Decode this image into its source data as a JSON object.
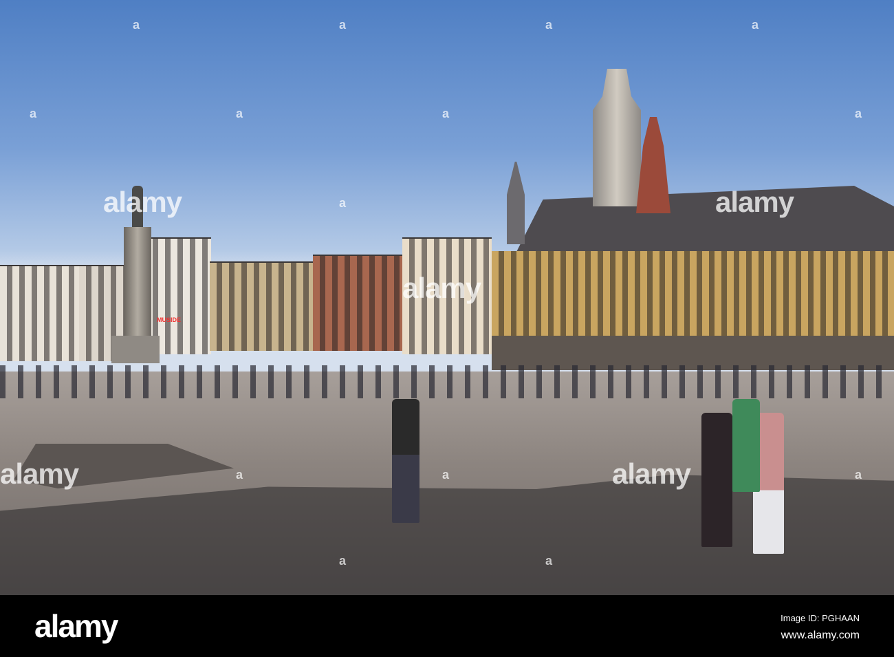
{
  "watermark": {
    "text": "alamy",
    "dot": "a"
  },
  "sign": {
    "text": "MUSIDE"
  },
  "footer": {
    "logo": "alamy",
    "image_id": "Image ID: PGHAAN",
    "url": "www.alamy.com"
  },
  "colors": {
    "sky": "#6f98d2",
    "ground": "#8d8580",
    "facade": "#c9a560"
  }
}
